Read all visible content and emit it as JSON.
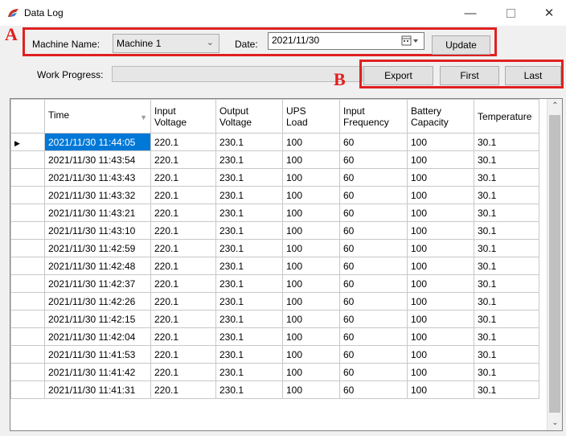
{
  "window": {
    "title": "Data Log",
    "minimize": "—",
    "close": "✕"
  },
  "filters": {
    "machine_label": "Machine Name:",
    "machine_value": "Machine 1",
    "date_label": "Date:",
    "date_value": "2021/11/30",
    "update_label": "Update"
  },
  "progress": {
    "label": "Work Progress:",
    "value": 0
  },
  "actions": {
    "export_label": "Export",
    "first_label": "First",
    "last_label": "Last"
  },
  "annotations": {
    "a": "A",
    "b": "B",
    "color": "#e02020"
  },
  "table": {
    "columns": [
      {
        "line1": "Time",
        "line2": ""
      },
      {
        "line1": "Input",
        "line2": "Voltage"
      },
      {
        "line1": "Output",
        "line2": "Voltage"
      },
      {
        "line1": "UPS",
        "line2": "Load"
      },
      {
        "line1": "Input",
        "line2": "Frequency"
      },
      {
        "line1": "Battery",
        "line2": "Capacity"
      },
      {
        "line1": "Temperature",
        "line2": ""
      }
    ],
    "selected_row": 0,
    "rows": [
      [
        "2021/11/30 11:44:05",
        "220.1",
        "230.1",
        "100",
        "60",
        "100",
        "30.1"
      ],
      [
        "2021/11/30 11:43:54",
        "220.1",
        "230.1",
        "100",
        "60",
        "100",
        "30.1"
      ],
      [
        "2021/11/30 11:43:43",
        "220.1",
        "230.1",
        "100",
        "60",
        "100",
        "30.1"
      ],
      [
        "2021/11/30 11:43:32",
        "220.1",
        "230.1",
        "100",
        "60",
        "100",
        "30.1"
      ],
      [
        "2021/11/30 11:43:21",
        "220.1",
        "230.1",
        "100",
        "60",
        "100",
        "30.1"
      ],
      [
        "2021/11/30 11:43:10",
        "220.1",
        "230.1",
        "100",
        "60",
        "100",
        "30.1"
      ],
      [
        "2021/11/30 11:42:59",
        "220.1",
        "230.1",
        "100",
        "60",
        "100",
        "30.1"
      ],
      [
        "2021/11/30 11:42:48",
        "220.1",
        "230.1",
        "100",
        "60",
        "100",
        "30.1"
      ],
      [
        "2021/11/30 11:42:37",
        "220.1",
        "230.1",
        "100",
        "60",
        "100",
        "30.1"
      ],
      [
        "2021/11/30 11:42:26",
        "220.1",
        "230.1",
        "100",
        "60",
        "100",
        "30.1"
      ],
      [
        "2021/11/30 11:42:15",
        "220.1",
        "230.1",
        "100",
        "60",
        "100",
        "30.1"
      ],
      [
        "2021/11/30 11:42:04",
        "220.1",
        "230.1",
        "100",
        "60",
        "100",
        "30.1"
      ],
      [
        "2021/11/30 11:41:53",
        "220.1",
        "230.1",
        "100",
        "60",
        "100",
        "30.1"
      ],
      [
        "2021/11/30 11:41:42",
        "220.1",
        "230.1",
        "100",
        "60",
        "100",
        "30.1"
      ],
      [
        "2021/11/30 11:41:31",
        "220.1",
        "230.1",
        "100",
        "60",
        "100",
        "30.1"
      ]
    ]
  }
}
